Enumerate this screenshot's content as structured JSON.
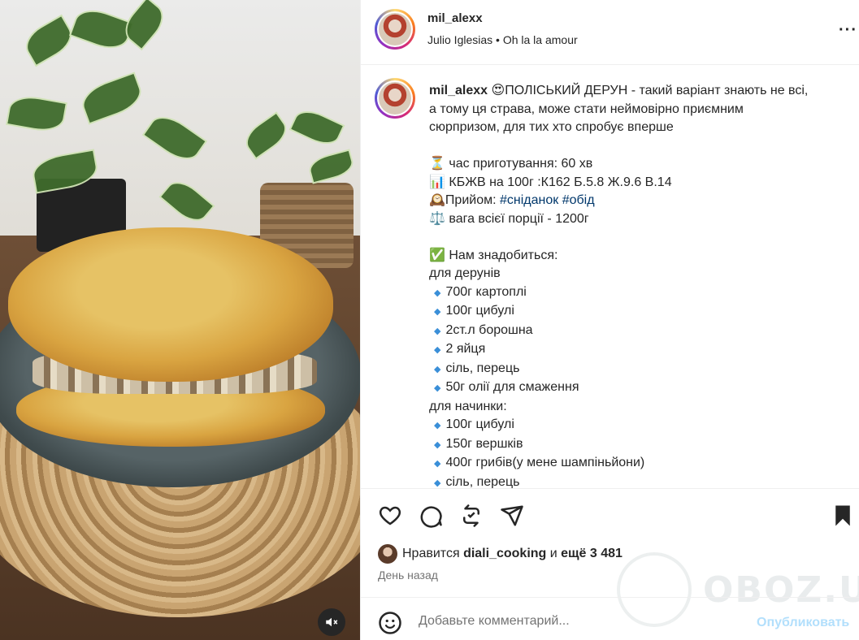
{
  "header": {
    "username": "mil_alexx",
    "audio": "Julio Iglesias • Oh la la amour"
  },
  "caption": {
    "username": "mil_alexx",
    "line1": " 😍ПОЛІСЬКИЙ ДЕРУН - такий варіант знають не всі,",
    "line2": "а тому ця страва, може стати неймовірно приємним",
    "line3": "сюрпризом, для тих хто спробує вперше",
    "prep_time": "⏳ час приготування: 60 хв",
    "kbzhv": "📊 КБЖВ на 100г :К162 Б.5.8 Ж.9.6 В.14",
    "meal_prefix": "🕰️Прийом: ",
    "tag1": "#сніданок",
    "tag2": "#обід",
    "weight": "⚖️ вага всієї порції - 1200г",
    "need": "✅ Нам знадобиться:",
    "for_deruny": "для дерунів",
    "deruny_items": [
      "700г картоплі",
      "100г цибулі",
      "2ст.л борошна",
      "2 яйця",
      "сіль, перець",
      "50г олії для смаження"
    ],
    "for_filling": "для начинки:",
    "filling_items": [
      "100г цибулі",
      "150г вершків",
      "400г грибів(у мене шампіньйони)",
      "сіль, перець"
    ]
  },
  "likes": {
    "prefix": "Нравится ",
    "user": "diali_cooking",
    "middle": " и ",
    "rest": "ещё 3 481"
  },
  "time": "День назад",
  "watermark": "OBOZ.UA",
  "comment": {
    "placeholder": "Добавьте комментарий...",
    "post_label": "Опубликовать"
  },
  "colors": {
    "accent": "#0095f6",
    "post_disabled": "#b2dffc",
    "hashtag": "#00376b"
  }
}
